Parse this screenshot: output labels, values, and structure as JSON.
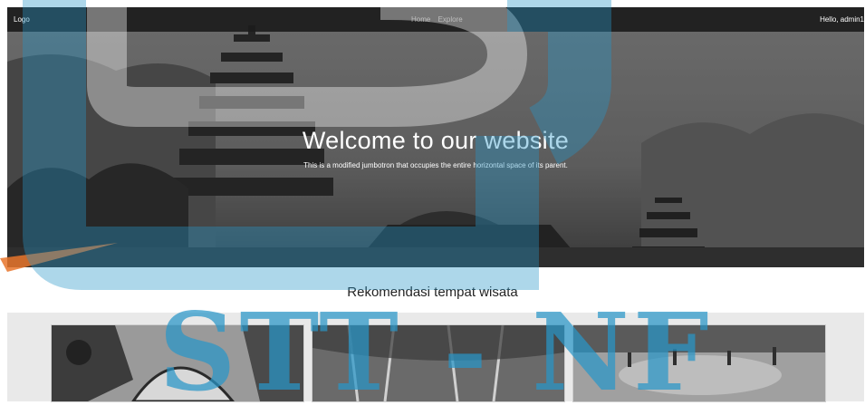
{
  "navbar": {
    "logo": "Logo",
    "links": [
      "Home",
      "Explore"
    ],
    "user_greeting": "Hello, admin1"
  },
  "hero": {
    "title": "Welcome to our website",
    "subtitle": "This is a modified jumbotron that occupies the entire horizontal space of its parent."
  },
  "recommendations": {
    "heading": "Rekomendasi tempat wisata"
  },
  "watermark": {
    "text": "STT - NF"
  },
  "colors": {
    "navbar_bg": "#1c1c1c",
    "watermark_blue": "#2896c8",
    "watermark_orange": "#e8742a"
  }
}
